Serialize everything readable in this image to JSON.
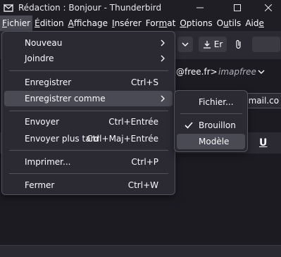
{
  "window": {
    "title": "Rédaction : Bonjour - Thunderbird",
    "minimize_glyph": "—",
    "maximize_glyph": "☐",
    "close_glyph": "✕"
  },
  "menubar": [
    {
      "label": "Fichier",
      "active": true
    },
    {
      "label": "Édition"
    },
    {
      "label": "Affichage"
    },
    {
      "label": "Insérer"
    },
    {
      "label": "Format"
    },
    {
      "label": "Options"
    },
    {
      "label": "Outils"
    },
    {
      "label": "Aide"
    }
  ],
  "compose": {
    "send_later_short": "Er",
    "from_email": "@free.fr>",
    "from_identity": "imapfree",
    "to_value": "gmail.co",
    "underline_glyph": "U"
  },
  "file_menu": {
    "new": "Nouveau",
    "attach": "Joindre",
    "save": "Enregistrer",
    "save_shortcut": "Ctrl+S",
    "save_as": "Enregistrer comme",
    "send": "Envoyer",
    "send_shortcut": "Ctrl+Entrée",
    "send_later": "Envoyer plus tard",
    "send_later_shortcut": "Ctrl+Maj+Entrée",
    "print": "Imprimer...",
    "print_shortcut": "Ctrl+P",
    "close": "Fermer",
    "close_shortcut": "Ctrl+W"
  },
  "save_as_submenu": {
    "file": "Fichier...",
    "draft": "Brouillon",
    "draft_checked": true,
    "template": "Modèle"
  },
  "colors": {
    "menu_bg": "#2b2a33",
    "hover_bg": "#4a4a55",
    "text": "#fbfbfe",
    "window_bg": "#1c1b22"
  }
}
